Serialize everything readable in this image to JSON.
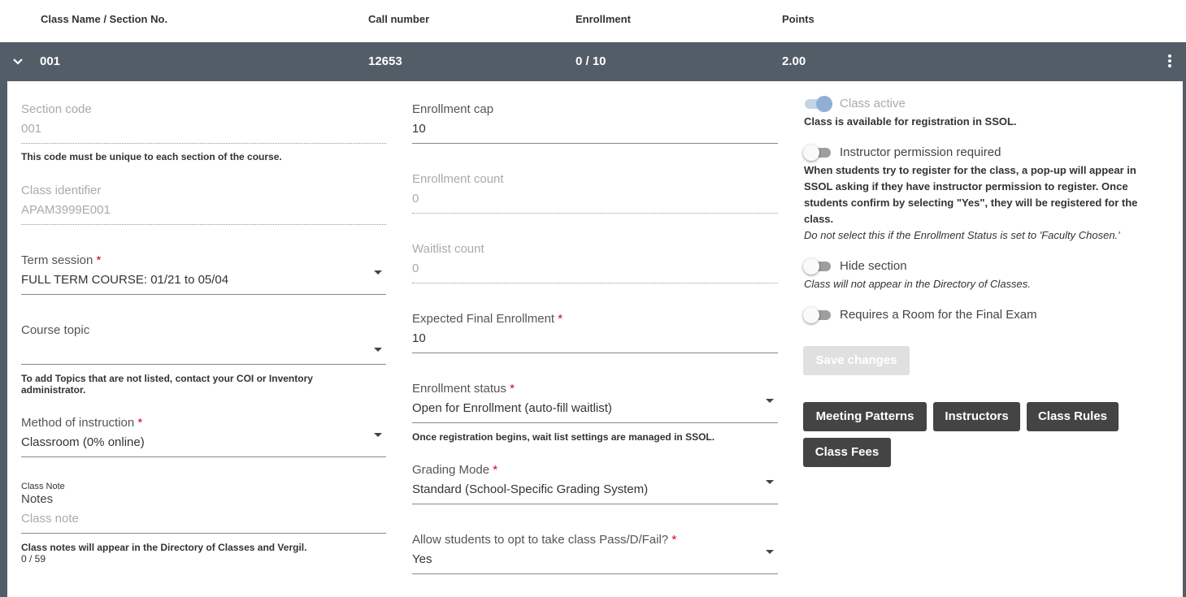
{
  "header": {
    "col_class": "Class Name / Section No.",
    "col_call": "Call number",
    "col_enrollment": "Enrollment",
    "col_points": "Points"
  },
  "section": {
    "name": "001",
    "call_number": "12653",
    "enrollment": "0 / 10",
    "points": "2.00"
  },
  "left": {
    "section_code": {
      "label": "Section code",
      "value": "001",
      "help": "This code must be unique to each section of the course."
    },
    "class_identifier": {
      "label": "Class identifier",
      "value": "APAM3999E001"
    },
    "term_session": {
      "label": "Term session",
      "value": "FULL TERM COURSE: 01/21 to 05/04"
    },
    "course_topic": {
      "label": "Course topic",
      "value": "",
      "help": "To add Topics that are not listed, contact your COI or Inventory administrator."
    },
    "method": {
      "label": "Method of instruction",
      "value": "Classroom (0% online)"
    },
    "class_note": {
      "small_label": "Class Note",
      "label": "Notes",
      "placeholder": "Class note",
      "help": "Class notes will appear in the Directory of Classes and Vergil.",
      "counter": "0 / 59"
    }
  },
  "middle": {
    "enrollment_cap": {
      "label": "Enrollment cap",
      "value": "10"
    },
    "enrollment_count": {
      "label": "Enrollment count",
      "value": "0"
    },
    "waitlist_count": {
      "label": "Waitlist count",
      "value": "0"
    },
    "expected_final": {
      "label": "Expected Final Enrollment",
      "value": "10"
    },
    "enrollment_status": {
      "label": "Enrollment status",
      "value": "Open for Enrollment (auto-fill waitlist)",
      "help": "Once registration begins, wait list settings are managed in SSOL."
    },
    "grading_mode": {
      "label": "Grading Mode",
      "value": "Standard (School-Specific Grading System)"
    },
    "pass_fail": {
      "label": "Allow students to opt to take class Pass/D/Fail?",
      "value": "Yes"
    }
  },
  "required_mark": "*",
  "right": {
    "class_active": {
      "label": "Class active",
      "desc": "Class is available for registration in SSOL.",
      "checked": true
    },
    "instructor_permission": {
      "label": "Instructor permission required",
      "desc": "When students try to register for the class, a pop-up will appear in SSOL asking if they have instructor permission to register. Once students confirm by selecting \"Yes\", they will be registered for the class.",
      "note": "Do not select this if the Enrollment Status is set to 'Faculty Chosen.'",
      "checked": false
    },
    "hide_section": {
      "label": "Hide section",
      "desc": "Class will not appear in the Directory of Classes.",
      "checked": false
    },
    "requires_room": {
      "label": "Requires a Room for the Final Exam",
      "checked": false
    },
    "save_label": "Save changes",
    "buttons": {
      "meeting_patterns": "Meeting Patterns",
      "instructors": "Instructors",
      "class_rules": "Class Rules",
      "class_fees": "Class Fees"
    }
  },
  "icons": {
    "expand": "chevron-down-icon",
    "menu": "kebab-menu-icon",
    "select": "caret-down-icon"
  },
  "colors": {
    "bar": "#535d67",
    "button": "#444444",
    "required": "#d0021b",
    "toggle_on": "#8fb0d3"
  }
}
